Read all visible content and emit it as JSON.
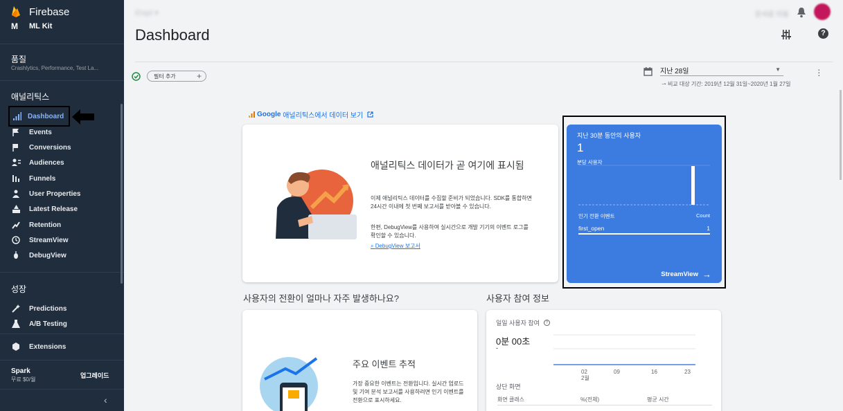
{
  "sidebar": {
    "brand": "Firebase",
    "mlkit_label": "ML Kit",
    "quality_title": "품질",
    "quality_sub": "Crashlytics, Performance, Test La...",
    "analytics_title": "애널리틱스",
    "analytics_items": [
      {
        "label": "Dashboard",
        "icon": "bar-chart-icon",
        "active": true
      },
      {
        "label": "Events",
        "icon": "flag-icon"
      },
      {
        "label": "Conversions",
        "icon": "flag-outline-icon"
      },
      {
        "label": "Audiences",
        "icon": "audience-icon"
      },
      {
        "label": "Funnels",
        "icon": "funnel-icon"
      },
      {
        "label": "User Properties",
        "icon": "user-property-icon"
      },
      {
        "label": "Latest Release",
        "icon": "release-icon"
      },
      {
        "label": "Retention",
        "icon": "retention-icon"
      },
      {
        "label": "StreamView",
        "icon": "clock-icon"
      },
      {
        "label": "DebugView",
        "icon": "debug-icon"
      }
    ],
    "grow_title": "성장",
    "grow_items": [
      {
        "label": "Predictions",
        "icon": "wand-icon"
      },
      {
        "label": "A/B Testing",
        "icon": "flask-icon"
      }
    ],
    "extensions_label": "Extensions",
    "plan_name": "Spark",
    "plan_price": "무료 $0/월",
    "upgrade_label": "업그레이드",
    "active_color": "#8ab4f8",
    "bg_color": "#1f2d3d"
  },
  "header": {
    "project": "iDapl",
    "top_right": "문서로 이동",
    "page_title": "Dashboard"
  },
  "filters": {
    "add_filter": "필터 추가",
    "date_range": "지난 28일",
    "compare_text": "비교 대상 기간: 2019년 12월 31일~2020년 1월 27일"
  },
  "ga_link": {
    "brand": "Google",
    "text": "애널리틱스에서 데이터 보기"
  },
  "main_card": {
    "title": "애널리틱스 데이터가 곧 여기에 표시됨",
    "desc1": "이제 애널리틱스 데이터를 수집할 준비가 되었습니다. SDK를 통합하면 24시간 이내에 첫 번째 보고서를 받아볼 수 있습니다.",
    "desc2": "한편, DebugView를 사용하여 실시간으로 개발 기기의 이벤트 로그를 확인할 수 있습니다.",
    "debug_link": "DebugView 보고서"
  },
  "realtime_card": {
    "title": "지난 30분 동안의 사용자",
    "count": "1",
    "per_minute": "분당 사용자",
    "events_head": "인기 전환 이벤트",
    "count_head": "Count",
    "event_name": "first_open",
    "event_count": "1",
    "footer": "StreamView",
    "bg_color": "#3c7be0"
  },
  "sections": {
    "conversion_question": "사용자의 전환이 얼마나 자주 발생하나요?",
    "engagement_title": "사용자 참여 정보"
  },
  "conversion_card": {
    "title": "주요 이벤트 추적",
    "desc": "가장 중요한 이벤트는 전환입니다. 실시간 업로드 및 기여 분석 보고서를 사용하려면 인기 이벤트를 전환으로 표시하세요."
  },
  "engagement_card": {
    "title": "일일 사용자 참여",
    "value": "0분 00초",
    "dash": "-",
    "ticks": [
      "02",
      "09",
      "16",
      "23"
    ],
    "month_label": "2월",
    "screens_title": "상단 화면",
    "col_screen": "화면 클래스",
    "col_percent": "%(전체)",
    "col_avg": "평균 시간"
  }
}
